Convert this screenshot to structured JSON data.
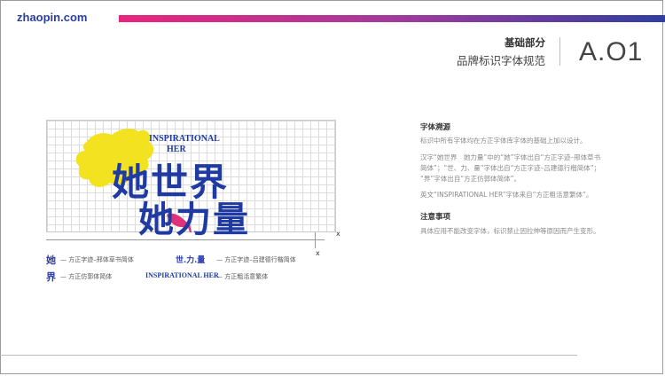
{
  "brand": "zhaopin.com",
  "colors": {
    "gradient_start": "#e8257d",
    "gradient_end": "#2f3ea0",
    "logo_blue": "#1f3aa2",
    "logo_yellow": "#f2e21f",
    "heel_pink": "#e0327a"
  },
  "section": {
    "title": "基础部分",
    "subtitle": "品牌标识字体规范",
    "code": "A.O1"
  },
  "logo": {
    "en_line1": "INSPIRATIONAL",
    "en_line2": "HER",
    "cn_line1": "她世界",
    "cn_line2": "她力量"
  },
  "marks": {
    "x1": "x",
    "x2": "x"
  },
  "legend": [
    {
      "glyph": "她",
      "text": "— 方正字迹–邢体草书简体"
    },
    {
      "glyph": "世.力.量",
      "text": "— 方正字迹–吕建德行楷简体"
    },
    {
      "glyph": "界",
      "text": "— 方正仿郭体简体"
    },
    {
      "glyph": "INSPIRATIONAL HER",
      "text": "— 方正粗活意繁体"
    }
  ],
  "info": {
    "h1": "字体溯源",
    "p1": "标识中所有字体均在方正字体库字体的基础上加以设计。",
    "p2a": "汉字“她世界　她力量”中的“她”字体出自“方正字迹–邢体草书",
    "p2b": "简体”；“世、力、量”字体出自“方正字迹–吕建德行楷简体”；",
    "p2c": "“界”字体出自“方正仿郭体简体”。",
    "p3": "英文“INSPIRATIONAL HER”字体来自“方正粗活意繁体”。",
    "h2": "注意事项",
    "p4": "具体应用不能改变字体，标识禁止因拉伸等原因而产生变形。"
  }
}
